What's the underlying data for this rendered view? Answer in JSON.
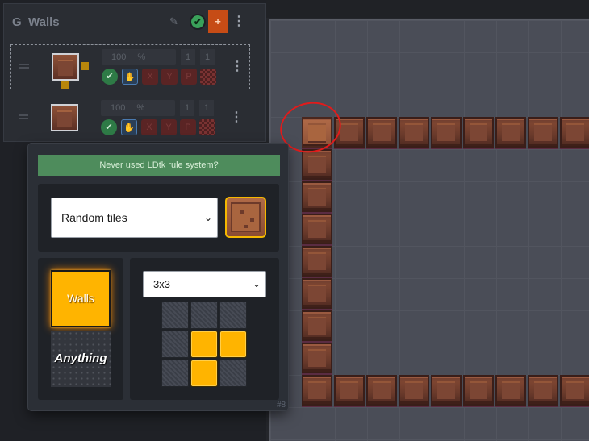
{
  "layer": {
    "name": "G_Walls",
    "add_label": "+",
    "menu_glyph": "⋮",
    "pencil_glyph": "✎",
    "check_glyph": "✔"
  },
  "rules": [
    {
      "selected": true,
      "chance_value": "100",
      "chance_unit": "%",
      "x_value": "1",
      "y_value": "1",
      "check_glyph": "✔",
      "hand_glyph": "✋",
      "flag_x": "X",
      "flag_y": "Y",
      "flag_p": "P",
      "menu_glyph": "⋮"
    },
    {
      "selected": false,
      "chance_value": "100",
      "chance_unit": "%",
      "x_value": "1",
      "y_value": "1",
      "check_glyph": "✔",
      "hand_glyph": "✋",
      "flag_x": "X",
      "flag_y": "Y",
      "flag_p": "P",
      "menu_glyph": "⋮"
    }
  ],
  "editor": {
    "help_text": "Never used LDtk rule system?",
    "tile_mode": "Random tiles",
    "values": {
      "primary": "Walls",
      "secondary": "Anything"
    },
    "pattern_size": "3x3",
    "pattern_cells": [
      0,
      0,
      0,
      0,
      1,
      1,
      0,
      1,
      0
    ],
    "rule_id": "#8",
    "chevron": "⌄"
  },
  "colors": {
    "accent_orange": "#c64c16",
    "value_walls": "#ffb400",
    "banner_green": "#4e8c5c",
    "annotation_red": "#e11b1b"
  }
}
